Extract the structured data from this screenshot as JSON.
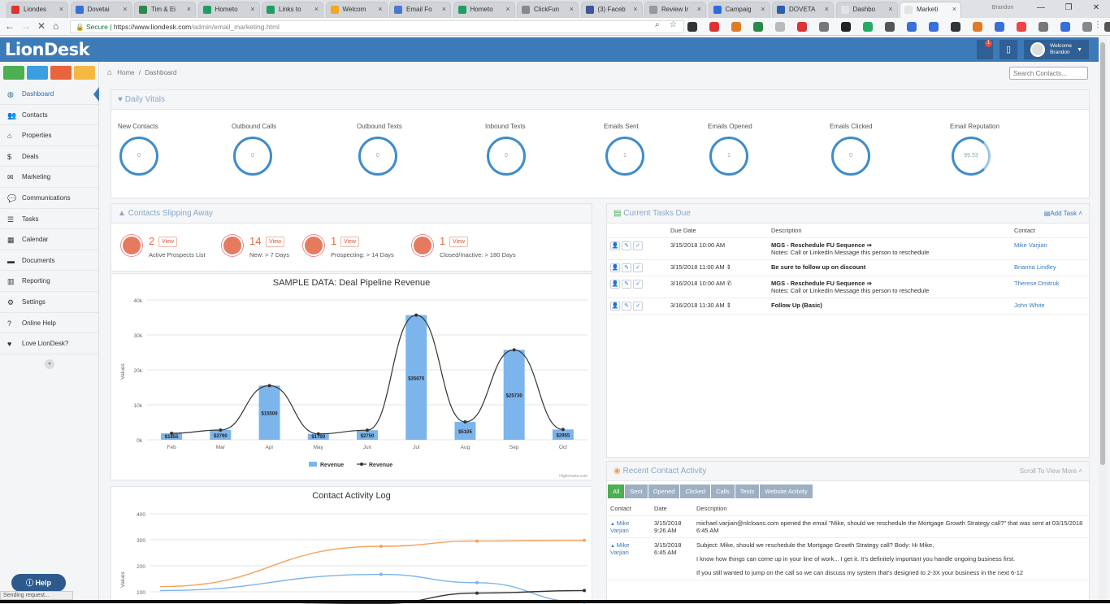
{
  "browser": {
    "tabs": [
      {
        "label": "Liondes",
        "color": "#d33"
      },
      {
        "label": "Dovetai",
        "color": "#3a6fd8"
      },
      {
        "label": "Tim & Ei",
        "color": "#2a8a4a"
      },
      {
        "label": "Hometo",
        "color": "#1e9e62"
      },
      {
        "label": "Links to",
        "color": "#1e9e62"
      },
      {
        "label": "Welcom",
        "color": "#f5a623"
      },
      {
        "label": "Email Fo",
        "color": "#4a78d0"
      },
      {
        "label": "Hometo",
        "color": "#1e9e62"
      },
      {
        "label": "ClickFun",
        "color": "#888"
      },
      {
        "label": "(3) Faceb",
        "color": "#3b5998"
      },
      {
        "label": "Review Ir",
        "color": "#999"
      },
      {
        "label": "Campaig",
        "color": "#2b6de0"
      },
      {
        "label": "DOVETA",
        "color": "#2b5fb0"
      },
      {
        "label": "Dashbo",
        "color": "#e3e3e3"
      },
      {
        "label": "Marketi",
        "color": "#e3e3e3"
      }
    ],
    "profile": "Brandon",
    "url_scheme": "Secure",
    "url_host": "https://www.liondesk.com",
    "url_path": "/admin/email_marketing.html"
  },
  "app": {
    "logo": "LionDesk",
    "welcome": "Welcome",
    "user": "Brandon",
    "notification_count": "1",
    "quick_buttons": [
      {
        "color": "#4caf50"
      },
      {
        "color": "#3b9ee0"
      },
      {
        "color": "#e9643d"
      },
      {
        "color": "#f5b942"
      }
    ]
  },
  "sidebar": {
    "items": [
      {
        "label": "Dashboard",
        "icon": "dashboard-icon",
        "glyph": "◍"
      },
      {
        "label": "Contacts",
        "icon": "users-icon",
        "glyph": "👥"
      },
      {
        "label": "Properties",
        "icon": "home-icon",
        "glyph": "⌂"
      },
      {
        "label": "Deals",
        "icon": "dollar-icon",
        "glyph": "$"
      },
      {
        "label": "Marketing",
        "icon": "envelope-icon",
        "glyph": "✉"
      },
      {
        "label": "Communications",
        "icon": "chat-icon",
        "glyph": "💬"
      },
      {
        "label": "Tasks",
        "icon": "list-icon",
        "glyph": "☰"
      },
      {
        "label": "Calendar",
        "icon": "calendar-icon",
        "glyph": "▦"
      },
      {
        "label": "Documents",
        "icon": "folder-icon",
        "glyph": "▬"
      },
      {
        "label": "Reporting",
        "icon": "chart-icon",
        "glyph": "▥"
      },
      {
        "label": "Settings",
        "icon": "gear-icon",
        "glyph": "⚙"
      },
      {
        "label": "Online Help",
        "icon": "question-icon",
        "glyph": "?"
      },
      {
        "label": "Love LionDesk?",
        "icon": "heart-icon",
        "glyph": "♥"
      }
    ]
  },
  "breadcrumb": {
    "home": "Home",
    "sep": "/",
    "current": "Dashboard"
  },
  "search": {
    "placeholder": "Search Contacts..."
  },
  "vitals": {
    "title": "Daily Vitals",
    "items": [
      {
        "label": "New Contacts",
        "value": "0"
      },
      {
        "label": "Outbound Calls",
        "value": "0"
      },
      {
        "label": "Outbound Texts",
        "value": "0"
      },
      {
        "label": "Inbound Texts",
        "value": "0"
      },
      {
        "label": "Emails Sent",
        "value": "1"
      },
      {
        "label": "Emails Opened",
        "value": "1"
      },
      {
        "label": "Emails Clicked",
        "value": "0"
      },
      {
        "label": "Email Reputation",
        "value": "99.53"
      }
    ]
  },
  "slipping": {
    "title": "Contacts Slipping Away",
    "view_label": "View",
    "items": [
      {
        "count": "2",
        "label": "Active Prospects List"
      },
      {
        "count": "14",
        "label": "New: > 7 Days"
      },
      {
        "count": "1",
        "label": "Prospecting: > 14 Days"
      },
      {
        "count": "1",
        "label": "Closed/Inactive: > 180 Days"
      }
    ]
  },
  "pipeline": {
    "credit": "Highcharts.com",
    "legend_bar": "Revenue",
    "legend_line": "Revenue",
    "value_labels": [
      "$1855",
      "$2790",
      "$15500",
      "$1700",
      "$2750",
      "$35670",
      "$5105",
      "$25730",
      "$2955"
    ]
  },
  "chart_data": [
    {
      "type": "bar",
      "title": "SAMPLE DATA: Deal Pipeline Revenue",
      "ylabel": "Values",
      "categories": [
        "Feb",
        "Mar",
        "Apr",
        "May",
        "Jun",
        "Jul",
        "Aug",
        "Sep",
        "Oct"
      ],
      "yticks": [
        "0k",
        "10k",
        "20k",
        "30k",
        "40k"
      ],
      "ylim": [
        0,
        40000
      ],
      "series": [
        {
          "name": "Revenue",
          "kind": "bar",
          "color": "#7cb5ec",
          "values": [
            1855,
            2790,
            15500,
            1700,
            2750,
            35670,
            5105,
            25730,
            2955
          ]
        },
        {
          "name": "Revenue",
          "kind": "spline",
          "color": "#333333",
          "values": [
            1855,
            2790,
            15500,
            1700,
            2750,
            35670,
            5105,
            25730,
            2955
          ]
        }
      ]
    },
    {
      "type": "line",
      "title": "Contact Activity Log",
      "ylabel": "Values",
      "yticks": [
        "100",
        "200",
        "300",
        "400"
      ],
      "ylim": [
        100,
        450
      ],
      "series": [
        {
          "color": "#f7a35c",
          "values": [
            120,
            275,
            295,
            298
          ]
        },
        {
          "color": "#7cb5ec",
          "values": [
            105,
            167,
            135,
            60
          ]
        },
        {
          "color": "#333333",
          "values": [
            40,
            55,
            95,
            105
          ]
        }
      ]
    }
  ],
  "tasks": {
    "title": "Current Tasks Due",
    "add_label": "Add Task",
    "columns": [
      "Due Date",
      "Description",
      "Contact"
    ],
    "rows": [
      {
        "due": "3/15/2018 10:00 AM",
        "desc": "MGS - Reschedule FU Sequence ⇒",
        "note": "Notes: Call or LinkedIn Message this person to reschedule",
        "contact": "Mike Varjian"
      },
      {
        "due": "3/15/2018 11:00 AM ⇕",
        "desc": "Be sure to follow up on discount",
        "note": "",
        "contact": "Brianna Lindley"
      },
      {
        "due": "3/16/2018 10:00 AM ✆",
        "desc": "MGS - Reschedule FU Sequence ⇒",
        "note": "Notes: Call or LinkedIn Message this person to reschedule",
        "contact": "Therese Dmitruk"
      },
      {
        "due": "3/16/2018 11:30 AM ⇕",
        "desc": "Follow Up (Basic)",
        "note": "",
        "contact": "John White"
      }
    ]
  },
  "activity": {
    "title": "Recent Contact Activity",
    "scroll_label": "Scroll To View More",
    "filters": [
      "All",
      "Sent",
      "Opened",
      "Clicked",
      "Calls",
      "Texts",
      "Website Activity"
    ],
    "columns": [
      "Contact",
      "Date",
      "Description"
    ],
    "rows": [
      {
        "contact": "Mike Varjian",
        "date": "3/15/2018 9:26 AM",
        "desc": "michael.varjian@nlcloans.com opened the email \"Mike, should we reschedule the Mortgage Growth Strategy call?\" that was sent at 03/15/2018 6:45 AM"
      },
      {
        "contact": "Mike Varjian",
        "date": "3/15/2018 6:45 AM",
        "desc": "Subject: Mike, should we reschedule the Mortgage Growth Strategy call? Body: Hi Mike,",
        "desc2": "I know how things can come up in your line of work... I get it. It's definitely important you handle ongoing business first.",
        "desc3": "If you still wanted to jump on the call so we can discuss my system that's designed to 2-3X your business in the next 6-12"
      }
    ]
  },
  "help_label": "Help",
  "status_text": "Sending request..."
}
